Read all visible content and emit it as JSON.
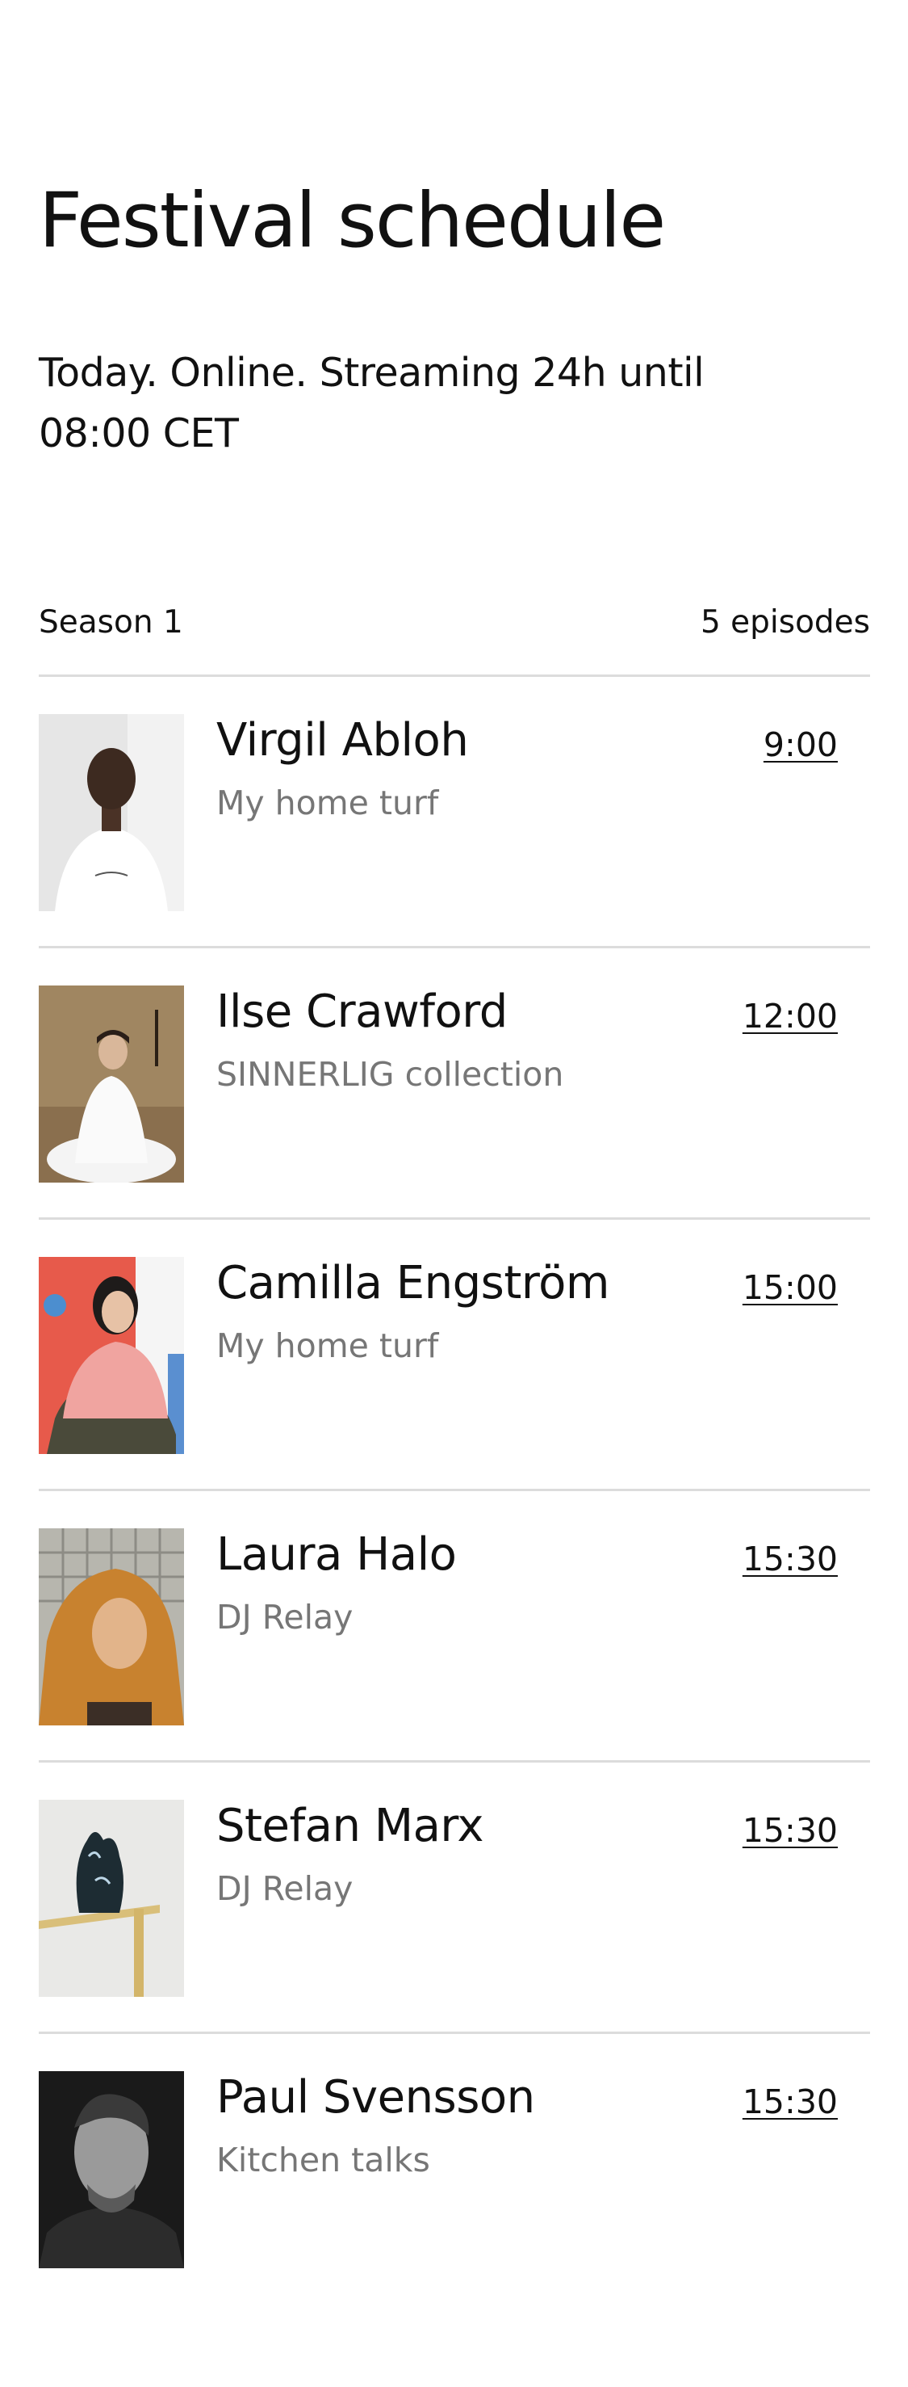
{
  "header": {
    "title": "Festival schedule",
    "subtitle": "Today. Online. Streaming 24h until 08:00 CET"
  },
  "season": {
    "label": "Season 1",
    "episodes_count": "5 episodes"
  },
  "episodes": [
    {
      "name": "Virgil Abloh",
      "topic": "My home turf",
      "time": "9:00",
      "photo": "virgil-abloh-photo"
    },
    {
      "name": "Ilse Crawford",
      "topic": "SINNERLIG collection",
      "time": "12:00",
      "photo": "ilse-crawford-photo"
    },
    {
      "name": "Camilla Engström",
      "topic": "My home turf",
      "time": "15:00",
      "photo": "camilla-engstrom-photo"
    },
    {
      "name": "Laura Halo",
      "topic": "DJ Relay",
      "time": "15:30",
      "photo": "laura-halo-photo"
    },
    {
      "name": "Stefan Marx",
      "topic": "DJ Relay",
      "time": "15:30",
      "photo": "stefan-marx-photo"
    },
    {
      "name": "Paul Svensson",
      "topic": "Kitchen talks",
      "time": "15:30",
      "photo": "paul-svensson-photo"
    }
  ]
}
